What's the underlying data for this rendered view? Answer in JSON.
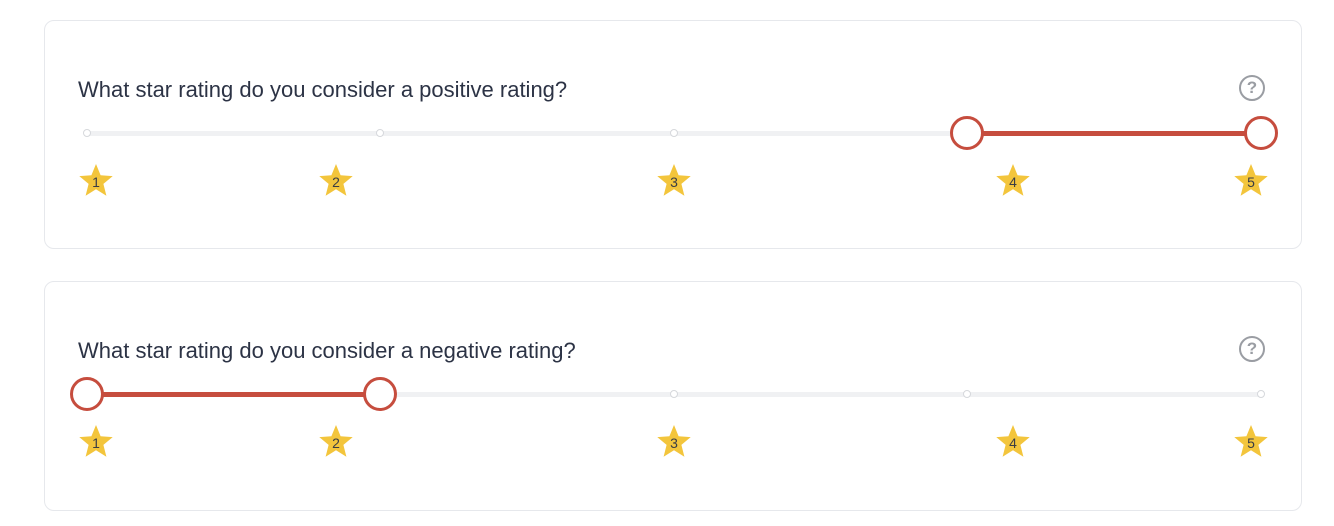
{
  "colors": {
    "accent": "#c64d3e",
    "star": "#f3c53c",
    "track": "#f0f1f3"
  },
  "questions": [
    {
      "label": "What star rating do you consider a positive rating?",
      "help_icon": "?",
      "range": [
        4,
        5
      ],
      "stars": [
        "1",
        "2",
        "3",
        "4",
        "5"
      ]
    },
    {
      "label": "What star rating do you consider a negative rating?",
      "help_icon": "?",
      "range": [
        1,
        2
      ],
      "stars": [
        "1",
        "2",
        "3",
        "4",
        "5"
      ]
    }
  ]
}
